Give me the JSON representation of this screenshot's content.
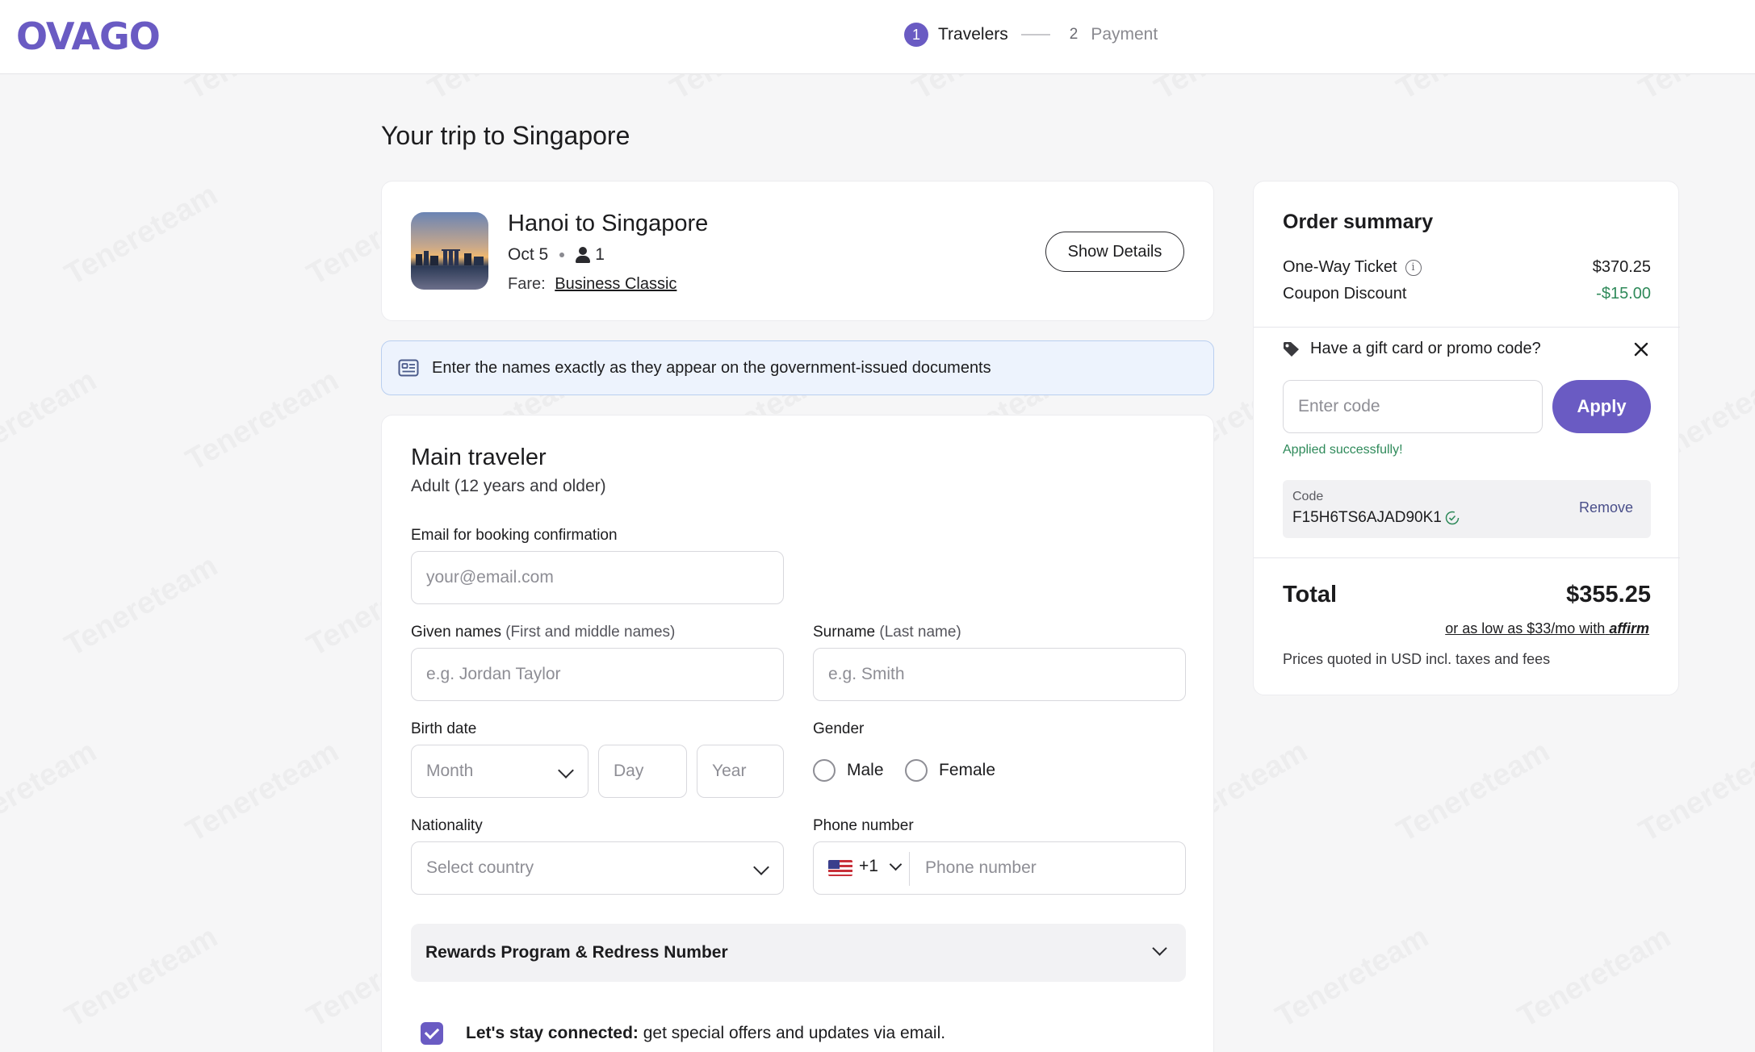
{
  "header": {
    "logo": "OVAGO",
    "steps": [
      {
        "num": "1",
        "label": "Travelers"
      },
      {
        "num": "2",
        "label": "Payment"
      }
    ]
  },
  "trip_title": "Your trip to Singapore",
  "flight": {
    "route": "Hanoi to Singapore",
    "date": "Oct 5",
    "passengers": "1",
    "fare_label": "Fare:",
    "fare_value": "Business Classic",
    "show_details": "Show Details"
  },
  "notice": "Enter the names exactly as they appear on the government-issued documents",
  "traveler": {
    "title": "Main traveler",
    "subtitle": "Adult (12 years and older)",
    "email_label": "Email for booking confirmation",
    "email_placeholder": "your@email.com",
    "given_label": "Given names",
    "given_hint": "(First and middle names)",
    "given_placeholder": "e.g. Jordan Taylor",
    "surname_label": "Surname",
    "surname_hint": "(Last name)",
    "surname_placeholder": "e.g. Smith",
    "birth_label": "Birth date",
    "month_placeholder": "Month",
    "day_placeholder": "Day",
    "year_placeholder": "Year",
    "gender_label": "Gender",
    "gender_options": [
      "Male",
      "Female"
    ],
    "nationality_label": "Nationality",
    "nationality_placeholder": "Select country",
    "phone_label": "Phone number",
    "phone_code": "+1",
    "phone_placeholder": "Phone number",
    "rewards_label": "Rewards Program & Redress Number",
    "stay_bold": "Let's stay connected:",
    "stay_text": "get special offers and updates via email."
  },
  "summary": {
    "title": "Order summary",
    "ticket_label": "One-Way Ticket",
    "ticket_value": "$370.25",
    "discount_label": "Coupon Discount",
    "discount_value": "-$15.00",
    "promo_question": "Have a gift card or promo code?",
    "code_placeholder": "Enter code",
    "apply_label": "Apply",
    "applied_msg": "Applied successfully!",
    "code_label": "Code",
    "code_value": "F15H6TS6AJAD90K1",
    "remove_label": "Remove",
    "total_label": "Total",
    "total_value": "$355.25",
    "affirm_text": "or as low as $33/mo with",
    "affirm_brand": "affirm",
    "prices_note": "Prices quoted in USD incl. taxes and fees"
  },
  "colors": {
    "accent": "#6a5bc3",
    "success": "#2f8a5a",
    "notice_bg": "#edf3fd"
  },
  "watermark": "Tenereteam"
}
